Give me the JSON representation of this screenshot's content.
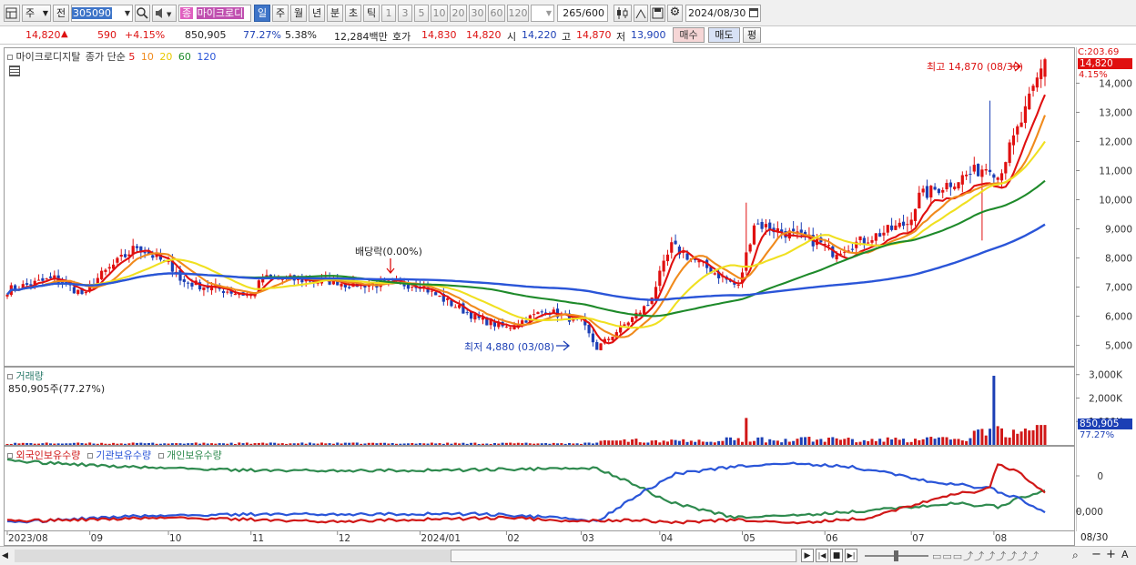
{
  "toolbar": {
    "market": "주",
    "code_mode": "전",
    "code": "305090",
    "stock_badge": "종",
    "stock_name": "마이크로디",
    "periods": [
      "일",
      "주",
      "월",
      "년",
      "분",
      "초",
      "틱"
    ],
    "selected_period": "일",
    "intervals": [
      "1",
      "3",
      "5",
      "10",
      "20",
      "30",
      "60",
      "120"
    ],
    "count": "265",
    "count_total": "/600",
    "date": "2024/08/30"
  },
  "quote": {
    "price": "14,820",
    "change": "590",
    "change_pct": "+4.15%",
    "volume": "850,905",
    "volume_ratio": "77.27%",
    "turnover": "5.38%",
    "amount": "12,284백만",
    "hoga_label": "호가",
    "ask": "14,830",
    "bid": "14,820",
    "open_label": "시",
    "open": "14,220",
    "high_label": "고",
    "high": "14,870",
    "low_label": "저",
    "low": "13,900",
    "buy_label": "매수",
    "sell_label": "매도",
    "eval_label": "평"
  },
  "main_panel": {
    "name": "마이크로디지탈",
    "ma_title": "종가 단순",
    "ma_periods": [
      "5",
      "10",
      "20",
      "60",
      "120"
    ],
    "ma_colors": [
      "#e01010",
      "#f08a1c",
      "#f0e020",
      "#1e8a2a",
      "#2a55d8"
    ],
    "up_color": "#e01010",
    "down_color": "#1c3fb5",
    "right_top": "C:203.69",
    "price_tag": "14,820",
    "pct_tag": "4.15%",
    "max_label": "최고 14,870 (08/30)",
    "min_label": "최저 4,880 (03/08)",
    "dividend_label": "배당락(0.00%)"
  },
  "volume_panel": {
    "title": "거래량",
    "sub": "850,905주(77.27%)",
    "tag": "850,905",
    "tag_pct": "77.27%"
  },
  "holding_panel": {
    "items": [
      "외국인보유수량",
      "기관보유수량",
      "개인보유수량"
    ],
    "colors": [
      "#d01818",
      "#2a55d8",
      "#2e8a4e"
    ]
  },
  "x_labels": [
    "2023/08",
    "09",
    "10",
    "11",
    "12",
    "2024/01",
    "02",
    "03",
    "04",
    "05",
    "06",
    "07",
    "08"
  ],
  "x_right": "08/30",
  "chart_data": [
    {
      "type": "candlestick",
      "title": "",
      "x_range": [
        "2023/08",
        "2024/08/30"
      ],
      "yticks": [
        5000,
        6000,
        7000,
        8000,
        9000,
        10000,
        11000,
        12000,
        13000,
        14000
      ],
      "ylim": [
        4300,
        15200
      ],
      "grid": false,
      "close_path": [
        {
          "x": "2023/08",
          "y": 6900
        },
        {
          "x": "2023/08 mid",
          "y": 7300
        },
        {
          "x": "2023/08 end",
          "y": 6700
        },
        {
          "x": "2023/09 start",
          "y": 7200
        },
        {
          "x": "2023/09 mid",
          "y": 8400
        },
        {
          "x": "2023/09 end",
          "y": 7600
        },
        {
          "x": "2023/10 start",
          "y": 7200
        },
        {
          "x": "2023/10 mid",
          "y": 6900
        },
        {
          "x": "2023/10 end",
          "y": 6700
        },
        {
          "x": "2023/11 start",
          "y": 7300
        },
        {
          "x": "2023/11 end",
          "y": 7200
        },
        {
          "x": "2023/12 start",
          "y": 7100
        },
        {
          "x": "2023/12 end",
          "y": 7100
        },
        {
          "x": "2024/01 start",
          "y": 6800
        },
        {
          "x": "2024/01 end",
          "y": 5900
        },
        {
          "x": "2024/02 start",
          "y": 5600
        },
        {
          "x": "2024/02 mid",
          "y": 6200
        },
        {
          "x": "2024/02 end",
          "y": 5800
        },
        {
          "x": "2024/03/08",
          "y": 4900
        },
        {
          "x": "2024/03 end",
          "y": 6400
        },
        {
          "x": "2024/04 start",
          "y": 8400
        },
        {
          "x": "2024/04 end",
          "y": 7000
        },
        {
          "x": "2024/05 start",
          "y": 9200
        },
        {
          "x": "2024/05 end",
          "y": 8500
        },
        {
          "x": "2024/06 start",
          "y": 8200
        },
        {
          "x": "2024/06 end",
          "y": 9200
        },
        {
          "x": "2024/07 start",
          "y": 10100
        },
        {
          "x": "2024/07 end",
          "y": 11200
        },
        {
          "x": "2024/08 start",
          "y": 10800
        },
        {
          "x": "2024/08 mid",
          "y": 13000
        },
        {
          "x": "2024/08/30",
          "y": 14820
        }
      ],
      "ma_end": {
        "ma5": 13600,
        "ma10": 12900,
        "ma20": 12000,
        "ma60": 10650,
        "ma120": 9150
      }
    },
    {
      "type": "bar",
      "title": "거래량",
      "yticks": [
        "1,000K",
        "2,000K",
        "3,000K"
      ],
      "ylim": [
        0,
        3300000
      ],
      "peaks": [
        {
          "x": "2024/05 start",
          "value": 1150000
        },
        {
          "x": "2024/08 mid",
          "value": 2950000
        },
        {
          "x": "2024/08/30",
          "value": 850905
        }
      ]
    },
    {
      "type": "line",
      "title": "보유수량",
      "yticks": [
        "0",
        "-500,000"
      ],
      "series": [
        {
          "name": "외국인보유수량",
          "shape": "low until 2024/06, rising in 07–08, spike 2024/08 then drop"
        },
        {
          "name": "기관보유수량",
          "shape": "low until 2024/03, jump to top in 04–05, decline through 08"
        },
        {
          "name": "개인보유수량",
          "shape": "high until 2024/03, falling to bottom by 05, rising in 07–08"
        }
      ]
    }
  ]
}
